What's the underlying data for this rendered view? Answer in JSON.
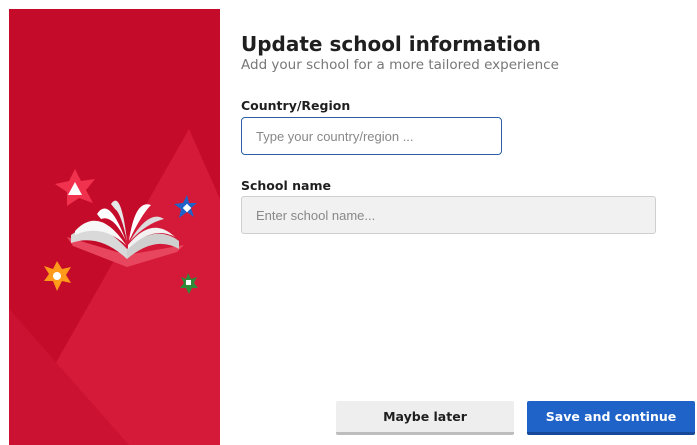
{
  "header": {
    "title": "Update school information",
    "subtitle": "Add your school for a more tailored experience"
  },
  "form": {
    "country": {
      "label": "Country/Region",
      "placeholder": "Type your country/region ...",
      "value": ""
    },
    "school": {
      "label": "School name",
      "placeholder": "Enter school name...",
      "value": ""
    }
  },
  "actions": {
    "later_label": "Maybe later",
    "save_label": "Save and continue"
  },
  "colors": {
    "brand_red": "#c50b2a",
    "primary_blue": "#1f63c9",
    "focus_border": "#2c5fa8"
  },
  "illustration": {
    "icons": [
      "open-book-icon",
      "red-star-icon",
      "blue-star-icon",
      "orange-star-icon",
      "green-star-icon"
    ]
  }
}
